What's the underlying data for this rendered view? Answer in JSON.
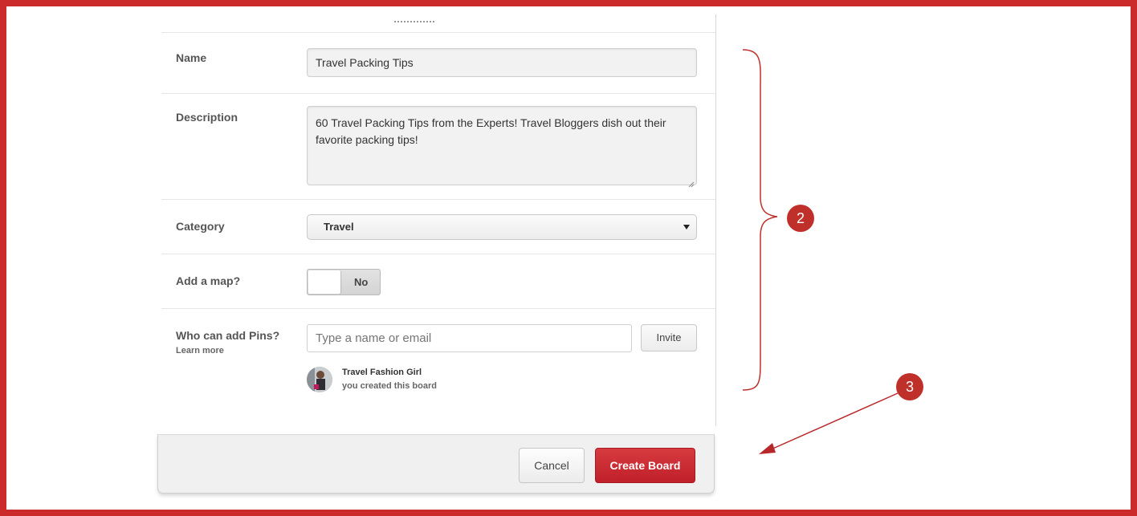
{
  "form": {
    "name_label": "Name",
    "name_value": "Travel Packing Tips",
    "description_label": "Description",
    "description_value": "60 Travel Packing Tips from the Experts! Travel Bloggers dish out their favorite packing tips!",
    "category_label": "Category",
    "category_value": "Travel",
    "map_label": "Add a map?",
    "map_toggle_value": "No",
    "pins_label": "Who can add Pins?",
    "learn_more": "Learn more",
    "invite_placeholder": "Type a name or email",
    "invite_button": "Invite",
    "collaborator_name": "Travel Fashion Girl",
    "collaborator_note": "you created this board"
  },
  "footer": {
    "cancel_label": "Cancel",
    "create_label": "Create Board"
  },
  "annotations": {
    "badge_2": "2",
    "badge_3": "3"
  },
  "colors": {
    "frame": "#cc2b2b",
    "create_button": "#c8232c",
    "annotation": "#c0302b"
  },
  "icons": {
    "select_arrow": "dropdown-arrow-icon",
    "resize_handle": "resize-handle-icon"
  }
}
